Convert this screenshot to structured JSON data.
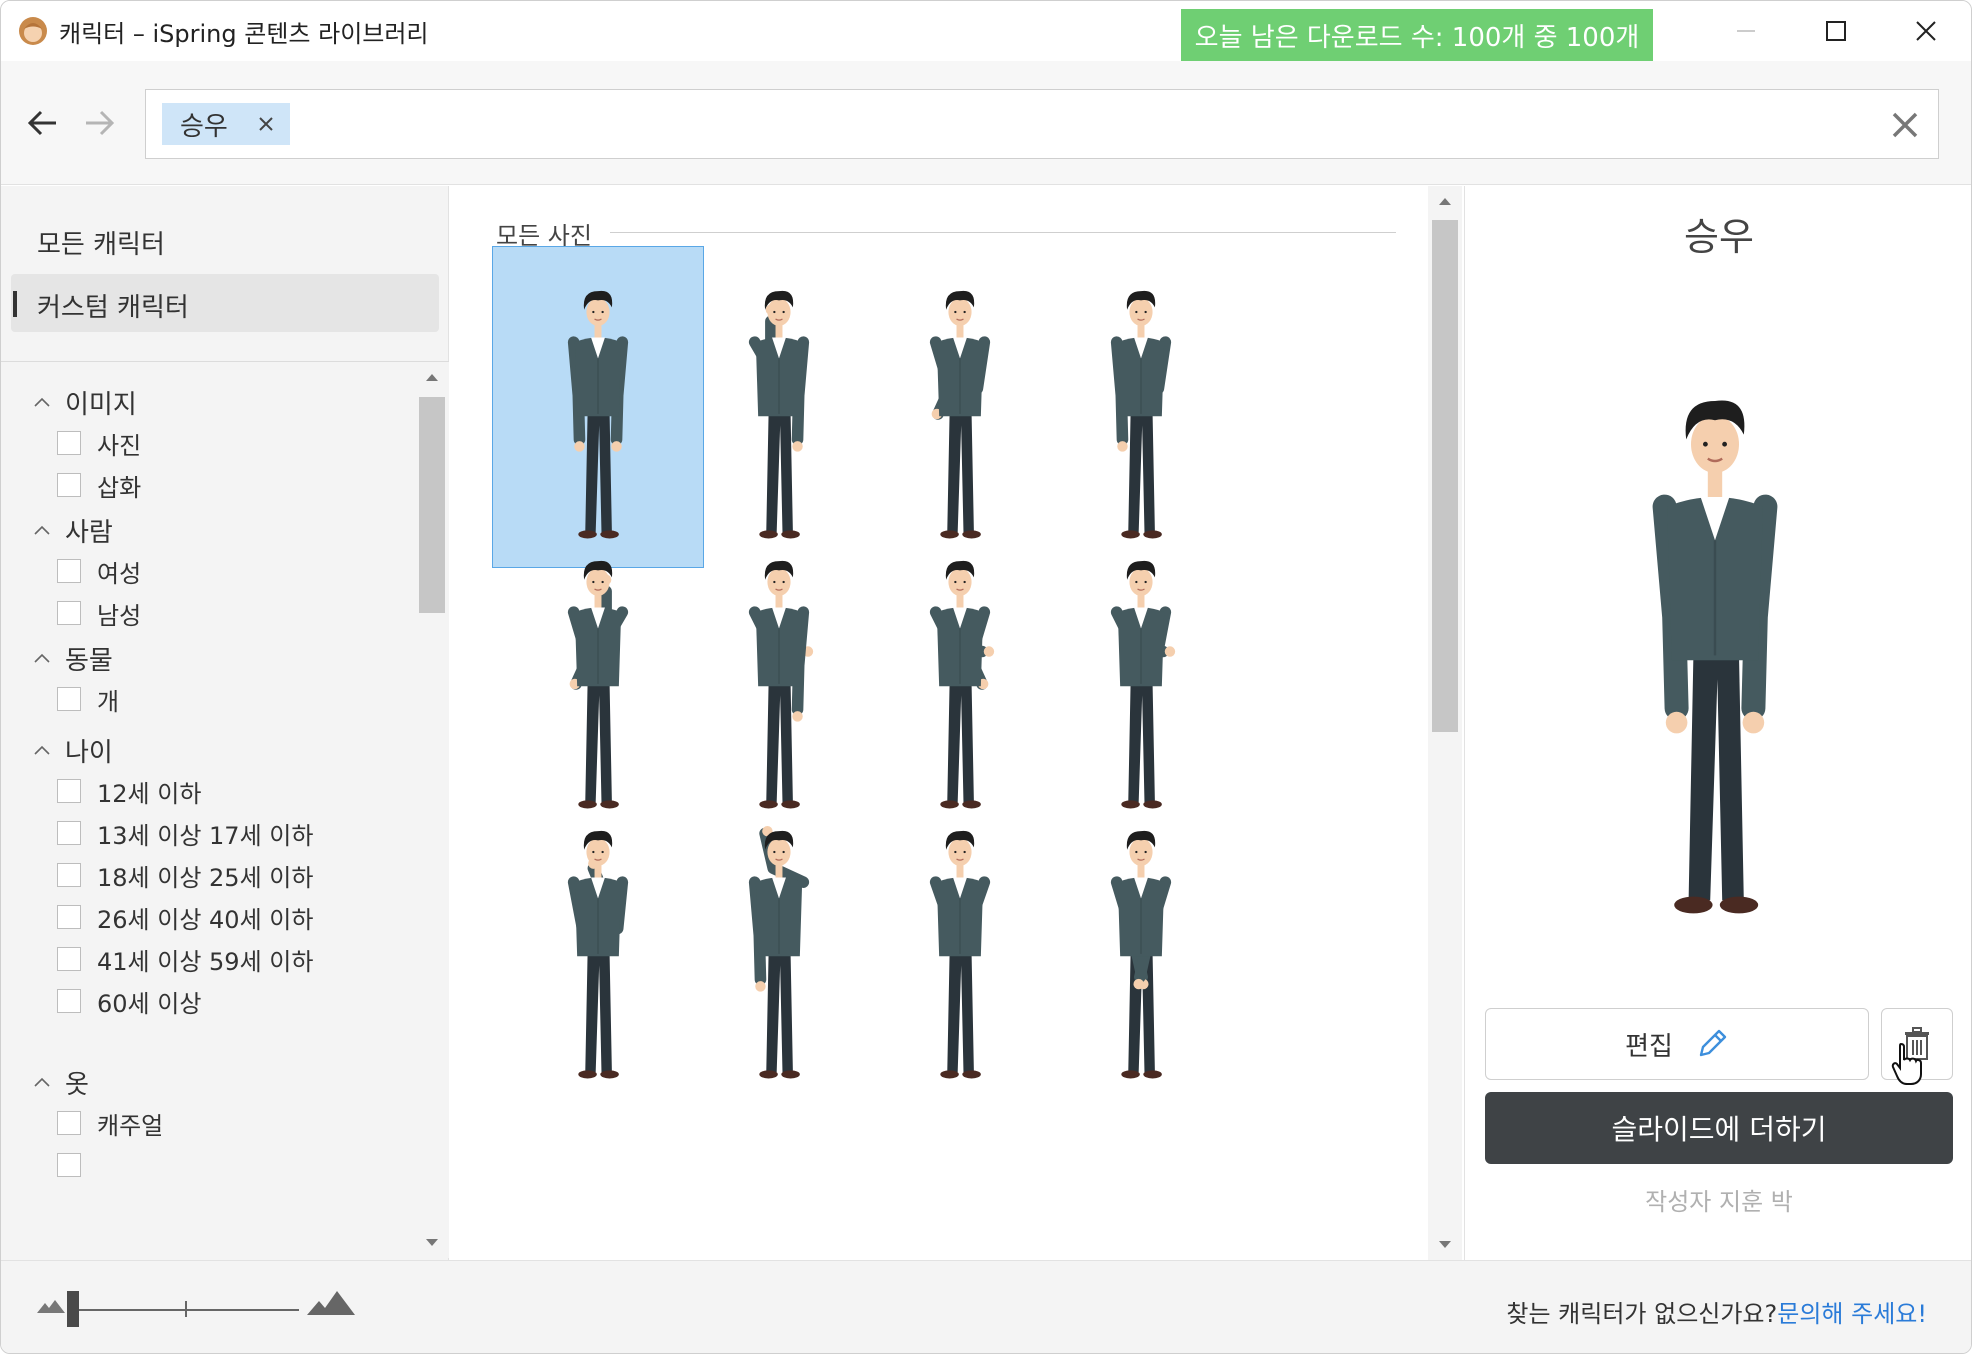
{
  "window": {
    "title": "캐릭터 – iSpring 콘텐츠 라이브러리",
    "download_counter": "오늘 남은 다운로드 수: 100개 중 100개"
  },
  "search": {
    "tag": "승우"
  },
  "sidebar": {
    "categories": [
      {
        "label": "모든 캐릭터",
        "active": false
      },
      {
        "label": "커스텀 캐릭터",
        "active": true
      }
    ],
    "filters": [
      {
        "header": "이미지",
        "options": [
          "사진",
          "삽화"
        ]
      },
      {
        "header": "사람",
        "options": [
          "여성",
          "남성"
        ]
      },
      {
        "header": "동물",
        "options": [
          "개"
        ]
      },
      {
        "header": "나이",
        "options": [
          "12세 이하",
          "13세 이상 17세 이하",
          "18세 이상 25세 이하",
          "26세 이상 40세 이하",
          "41세 이상 59세 이하",
          "60세 이상"
        ]
      },
      {
        "header": "옷",
        "options": [
          "캐주얼"
        ]
      }
    ]
  },
  "gallery": {
    "section_label": "모든 사진",
    "poses": [
      "standing",
      "wave",
      "thumbs-up",
      "thumbs-down",
      "point-up",
      "present-left",
      "present-left-hand-hip",
      "present-left-arm-folded",
      "thinking",
      "scratch-head",
      "shrug",
      "arms-down"
    ],
    "selected_index": 0
  },
  "preview": {
    "title": "승우",
    "edit_label": "편집",
    "add_label": "슬라이드에 더하기",
    "author": "작성자 지훈 박"
  },
  "footer": {
    "help_text": "찾는 캐릭터가 없으신가요?",
    "help_link": "문의해 주세요!"
  },
  "colors": {
    "accent_green": "#6fcf73",
    "selection": "#b8dbf6",
    "primary_button": "#3f4346",
    "link": "#2a7bd8",
    "cardigan": "#455a5f",
    "pants": "#2a343b"
  },
  "icons": {
    "app": "character-face-icon",
    "back": "arrow-left-icon",
    "forward": "arrow-right-icon",
    "clear": "close-icon",
    "edit": "pencil-icon",
    "delete": "trash-icon"
  }
}
